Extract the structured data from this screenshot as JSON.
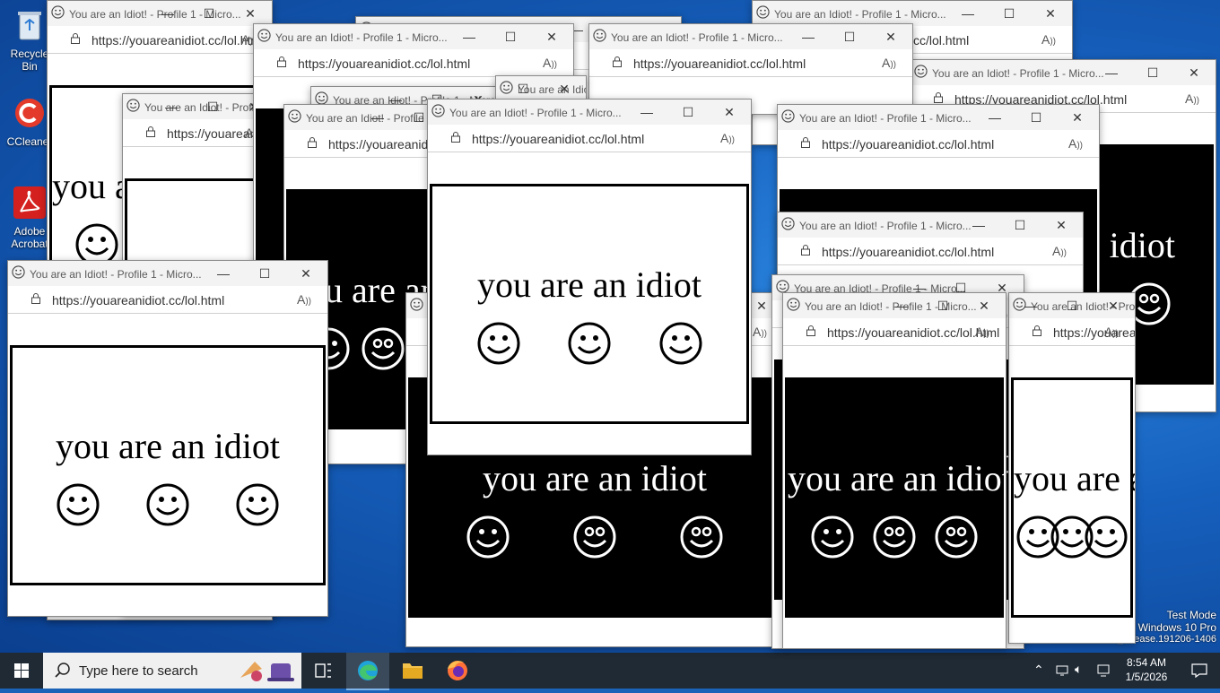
{
  "desktop": {
    "icons": [
      {
        "label": "Recycle Bin"
      },
      {
        "label": "CCleaner"
      },
      {
        "label": "Adobe Acrobat"
      }
    ]
  },
  "window": {
    "title": "You are an Idiot! - Profile 1 - Micro...",
    "url": "https://youareanidiot.cc/lol.html",
    "read_aloud": "A))",
    "phrase": "you are an idiot"
  },
  "taskbar": {
    "search_placeholder": "Type here to search",
    "time": "8:54 AM",
    "date": "1/5/2026"
  },
  "watermark": {
    "line1": "Test Mode",
    "line2": "Windows 10 Pro",
    "line3": "Build 19041.vb_release.191206-1406"
  },
  "colors": {
    "accent": "#0078d7",
    "taskbar": "#1f2a35",
    "inverted_bg": "#000000"
  }
}
